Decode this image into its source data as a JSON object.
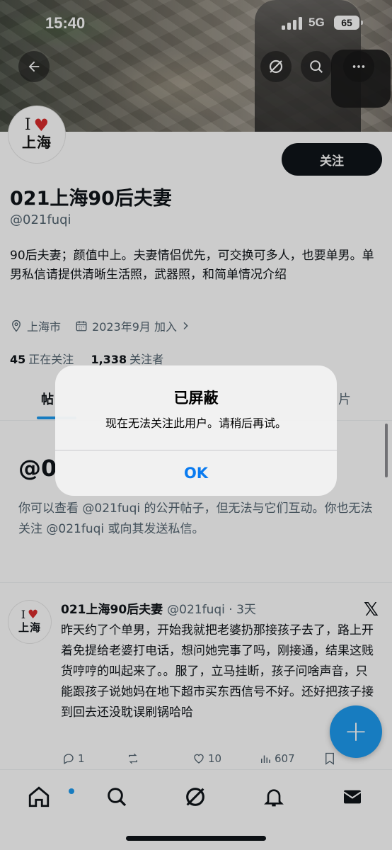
{
  "status_bar": {
    "time": "15:40",
    "network": "5G",
    "battery": "65"
  },
  "header_icons": {
    "back": "arrow-left-icon",
    "grok": "grok-icon",
    "search": "search-icon",
    "more": "more-icon"
  },
  "profile": {
    "avatar_line1": "I",
    "avatar_line2": "上海",
    "follow_label": "关注",
    "name": "021上海90后夫妻",
    "handle": "@021fuqi",
    "bio": "90后夫妻；颜值中上。夫妻情侣优先，可交换可多人，也要单男。单男私信请提供清晰生活照，武器照，和简单情况介绍",
    "location": "上海市",
    "joined": "2023年9月 加入",
    "following_count": "45",
    "following_label": "正在关注",
    "followers_count": "1,338",
    "followers_label": "关注者"
  },
  "tabs": {
    "posts_partial": "帖",
    "media_partial": "片"
  },
  "blocked": {
    "title_partial": "@0",
    "description": "你可以查看 @021fuqi 的公开帖子，但无法与它们互动。你也无法关注 @021fuqi 或向其发送私信。"
  },
  "tweet": {
    "name": "021上海90后夫妻",
    "handle": "@021fuqi · 3天",
    "text": "昨天约了个单男，开始我就把老婆扔那接孩子去了，路上开着免提给老婆打电话，想问她完事了吗，刚接通，结果这贱货哼哼的叫起来了。。服了，立马挂断，孩子问啥声音，只能跟孩子说她妈在地下超市买东西信号不好。还好把孩子接到回去还没耽误刷锅哈哈",
    "replies": "1",
    "likes": "10",
    "views": "607"
  },
  "fab_label": "+",
  "alert": {
    "title": "已屏蔽",
    "message": "现在无法关注此用户。请稍后再试。",
    "ok_label": "OK"
  },
  "colors": {
    "accent": "#1d9bf0",
    "ok_blue": "#0a7bf0",
    "heart": "#d92b2b"
  }
}
